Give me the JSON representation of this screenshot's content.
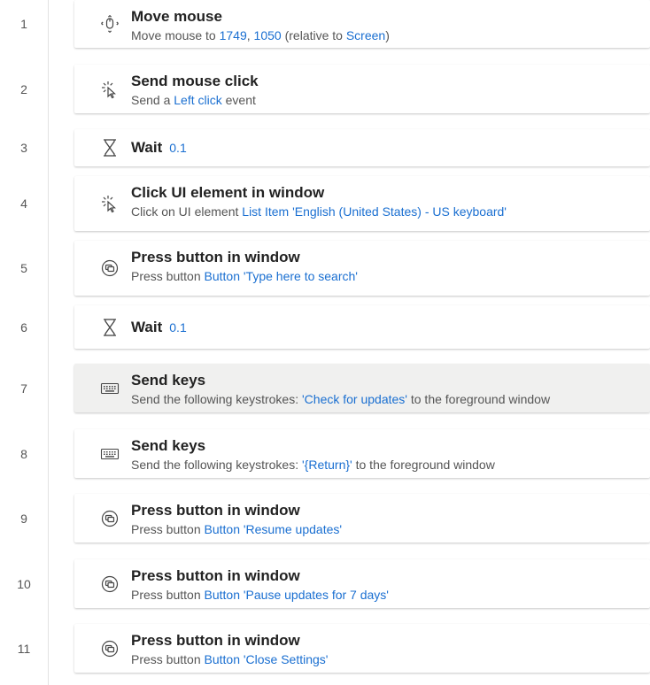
{
  "steps": [
    {
      "number": "1",
      "title": "Move mouse",
      "parts": [
        {
          "t": "Move mouse to "
        },
        {
          "t": "1749",
          "link": true
        },
        {
          "t": ", "
        },
        {
          "t": "1050",
          "link": true
        },
        {
          "t": " (relative to "
        },
        {
          "t": "Screen",
          "link": true
        },
        {
          "t": ")"
        }
      ],
      "icon": "move-mouse-icon"
    },
    {
      "number": "2",
      "title": "Send mouse click",
      "parts": [
        {
          "t": "Send a "
        },
        {
          "t": "Left click",
          "link": true
        },
        {
          "t": " event"
        }
      ],
      "icon": "mouse-click-icon"
    },
    {
      "number": "3",
      "title": "Wait",
      "inline": "0.1",
      "icon": "hourglass-icon"
    },
    {
      "number": "4",
      "title": "Click UI element in window",
      "parts": [
        {
          "t": "Click on UI element "
        },
        {
          "t": "List Item 'English (United States) - US keyboard'",
          "link": true
        }
      ],
      "icon": "mouse-click-icon"
    },
    {
      "number": "5",
      "title": "Press button in window",
      "parts": [
        {
          "t": "Press button "
        },
        {
          "t": "Button 'Type here to search'",
          "link": true
        }
      ],
      "icon": "press-button-icon"
    },
    {
      "number": "6",
      "title": "Wait",
      "inline": "0.1",
      "icon": "hourglass-icon"
    },
    {
      "number": "7",
      "title": "Send keys",
      "parts": [
        {
          "t": "Send the following keystrokes: "
        },
        {
          "t": "'Check for updates'",
          "link": true
        },
        {
          "t": " to the foreground window"
        }
      ],
      "icon": "keyboard-icon",
      "highlighted": true
    },
    {
      "number": "8",
      "title": "Send keys",
      "parts": [
        {
          "t": "Send the following keystrokes: "
        },
        {
          "t": "'{Return}'",
          "link": true
        },
        {
          "t": " to the foreground window"
        }
      ],
      "icon": "keyboard-icon"
    },
    {
      "number": "9",
      "title": "Press button in window",
      "parts": [
        {
          "t": "Press button "
        },
        {
          "t": "Button 'Resume updates'",
          "link": true
        }
      ],
      "icon": "press-button-icon"
    },
    {
      "number": "10",
      "title": "Press button in window",
      "parts": [
        {
          "t": "Press button "
        },
        {
          "t": "Button 'Pause updates for 7 days'",
          "link": true
        }
      ],
      "icon": "press-button-icon"
    },
    {
      "number": "11",
      "title": "Press button in window",
      "parts": [
        {
          "t": "Press button "
        },
        {
          "t": "Button 'Close Settings'",
          "link": true
        }
      ],
      "icon": "press-button-icon"
    }
  ]
}
